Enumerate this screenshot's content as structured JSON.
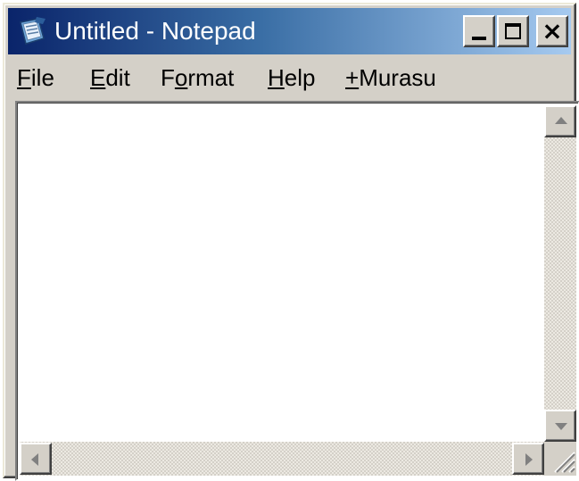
{
  "window": {
    "title": "Untitled - Notepad"
  },
  "caption_buttons": {
    "minimize": "minimize-icon",
    "maximize": "maximize-icon",
    "close": "×"
  },
  "menu": {
    "items": [
      {
        "access_key": "F",
        "rest": "ile"
      },
      {
        "access_key": "E",
        "rest": "dit"
      },
      {
        "prefix": "F",
        "access_key": "o",
        "rest": "rmat"
      },
      {
        "access_key": "H",
        "rest": "elp"
      },
      {
        "access_key": "+",
        "rest": "Murasu"
      }
    ]
  },
  "editor": {
    "content": ""
  },
  "colors": {
    "title_gradient_start": "#0a246a",
    "title_gradient_end": "#a6caf0",
    "face": "#d4d0c8"
  },
  "icons": {
    "app": "notepad-icon",
    "scroll_up": "arrow-up-icon",
    "scroll_down": "arrow-down-icon",
    "scroll_left": "arrow-left-icon",
    "scroll_right": "arrow-right-icon",
    "grip": "size-grip-icon"
  }
}
